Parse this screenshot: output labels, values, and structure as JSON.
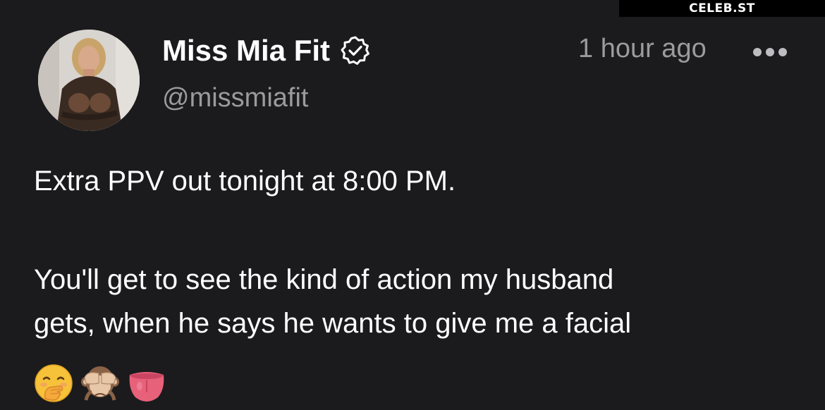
{
  "watermark": "CELEB.ST",
  "post": {
    "author": {
      "display_name": "Miss Mia Fit",
      "handle": "@missmiafit",
      "verified": true
    },
    "timestamp": "1 hour ago",
    "text_lines": [
      "Extra PPV out tonight at 8:00 PM.",
      "You'll get to see the kind of action my husband",
      "gets, when he says he wants to give me a facial"
    ],
    "emojis": [
      "face-with-hand-over-mouth",
      "see-no-evil-monkey",
      "tongue"
    ]
  },
  "icons": {
    "verified": "verified-badge-icon",
    "more": "more-options-icon"
  },
  "colors": {
    "background": "#1b1b1d",
    "text_primary": "#ffffff",
    "text_secondary": "#9a9a9f"
  }
}
